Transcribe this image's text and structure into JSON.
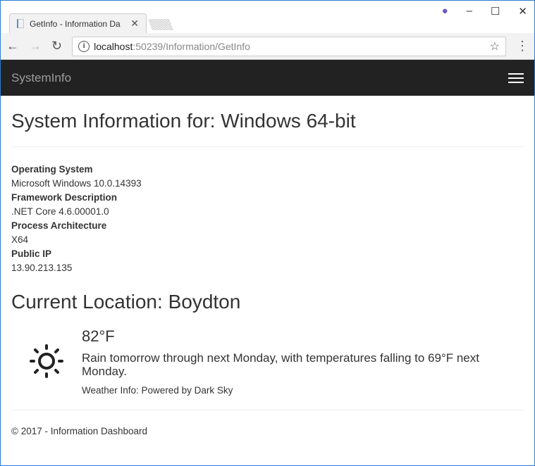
{
  "browser": {
    "tab_title": "GetInfo - Information Da",
    "url_host": "localhost",
    "url_path": ":50239/Information/GetInfo"
  },
  "navbar": {
    "brand": "SystemInfo"
  },
  "page": {
    "title": "System Information for: Windows 64-bit",
    "info": [
      {
        "label": "Operating System",
        "value": "Microsoft Windows 10.0.14393"
      },
      {
        "label": "Framework Description",
        "value": ".NET Core 4.6.00001.0"
      },
      {
        "label": "Process Architecture",
        "value": "X64"
      },
      {
        "label": "Public IP",
        "value": "13.90.213.135"
      }
    ],
    "location_title": "Current Location: Boydton",
    "weather": {
      "icon": "sun-icon",
      "temperature": "82°F",
      "summary": "Rain tomorrow through next Monday, with temperatures falling to 69°F next Monday.",
      "credit": "Weather Info: Powered by Dark Sky"
    },
    "footer": "© 2017 - Information Dashboard"
  }
}
